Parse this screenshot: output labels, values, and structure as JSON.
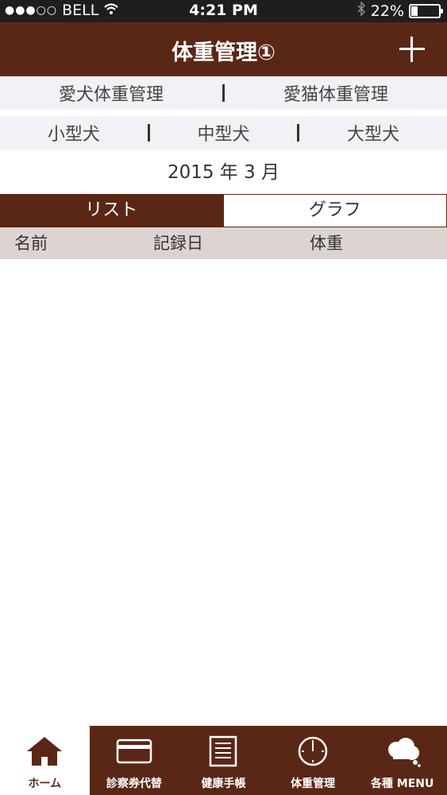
{
  "status": {
    "carrier": "BELL",
    "time": "4:21 PM",
    "battery": "22%",
    "battery_level": 0.22,
    "signal_dots": "●●●○○"
  },
  "nav": {
    "title": "体重管理①",
    "add_icon": "plus-icon"
  },
  "pet_type_tabs": [
    {
      "label": "愛犬体重管理"
    },
    {
      "label": "愛猫体重管理"
    }
  ],
  "size_tabs": [
    {
      "label": "小型犬"
    },
    {
      "label": "中型犬"
    },
    {
      "label": "大型犬"
    }
  ],
  "month": "2015 年 3 月",
  "view_tabs": {
    "list": "リスト",
    "graph": "グラフ",
    "selected": "list"
  },
  "list_header": {
    "name": "名前",
    "date": "記録日",
    "weight": "体重"
  },
  "tabbar": [
    {
      "label": "ホーム",
      "icon": "home-icon",
      "selected": true
    },
    {
      "label": "診察券代替",
      "icon": "card-icon",
      "selected": false
    },
    {
      "label": "健康手帳",
      "icon": "notebook-icon",
      "selected": false
    },
    {
      "label": "体重管理",
      "icon": "clock-icon",
      "selected": false
    },
    {
      "label": "各種 MENU",
      "icon": "cloud-menu-icon",
      "selected": false
    }
  ],
  "colors": {
    "brand": "#5a2716",
    "segment_bg": "#f0f2f5",
    "header_bg": "#ddd4d1"
  }
}
